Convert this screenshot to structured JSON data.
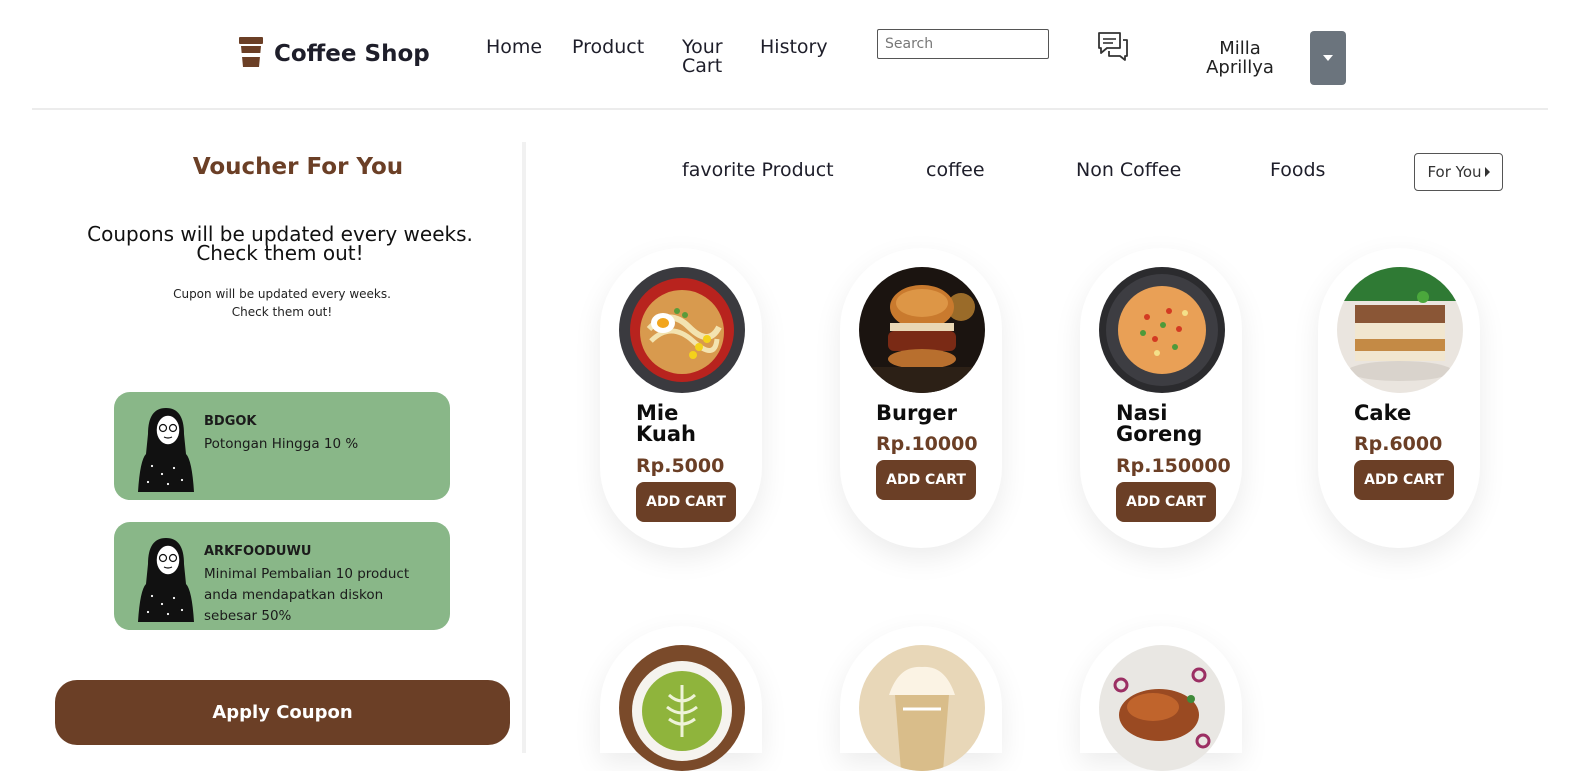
{
  "header": {
    "brand": "Coffee Shop",
    "nav": {
      "home": "Home",
      "product": "Product",
      "cart_line1": "Your",
      "cart_line2": "Cart",
      "history": "History"
    },
    "search_placeholder": "Search",
    "user_line1": "Milla",
    "user_line2": "Aprillya"
  },
  "voucher": {
    "title": "Voucher For You",
    "big_line1": "Coupons will be updated every weeks.",
    "big_line2": "Check them out!",
    "small_line1": "Cupon will be updated every weeks.",
    "small_line2": "Check them out!",
    "cards": [
      {
        "code": "BDGOK",
        "desc": "Potongan Hingga 10 %"
      },
      {
        "code": "ARKFOODUWU",
        "desc": "Minimal Pembalian 10 product anda mendapatkan diskon sebesar 50%"
      }
    ],
    "apply_label": "Apply Coupon"
  },
  "tabs": {
    "favorite": "favorite Product",
    "coffee": "coffee",
    "non_coffee": "Non Coffee",
    "foods": "Foods",
    "for_you": "For You"
  },
  "products": [
    {
      "name_line1": "Mie",
      "name_line2": "Kuah",
      "price": "Rp.5000",
      "button": "ADD CART"
    },
    {
      "name_line1": "Burger",
      "name_line2": "",
      "price": "Rp.10000",
      "button": "ADD CART"
    },
    {
      "name_line1": "Nasi",
      "name_line2": "Goreng",
      "price": "Rp.150000",
      "button": "ADD CART"
    },
    {
      "name_line1": "Cake",
      "name_line2": "",
      "price": "Rp.6000",
      "button": "ADD CART"
    }
  ],
  "icons": {
    "brand": "coffee-cup-icon",
    "chat": "chat-icon",
    "dropdown": "caret-down-icon",
    "for_you": "caret-right-icon"
  },
  "colors": {
    "brand_brown": "#6b3f26",
    "voucher_green": "#89b788",
    "dropdown_gray": "#6b747d"
  }
}
